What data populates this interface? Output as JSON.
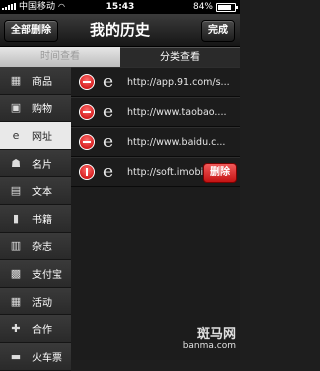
{
  "status_bar": {
    "carrier": "中国移动",
    "time": "15:43",
    "battery_text": "84%",
    "battery_level": 0.84
  },
  "navbar": {
    "left_button": "全部删除",
    "title": "我的历史",
    "right_button": "完成"
  },
  "tabs": [
    {
      "label": "时间查看",
      "active": false
    },
    {
      "label": "分类查看",
      "active": true
    }
  ],
  "sidebar": {
    "items": [
      {
        "label": "商品",
        "icon": "barcode-icon",
        "glyph": "▦",
        "active": false
      },
      {
        "label": "购物",
        "icon": "shopping-icon",
        "glyph": "▣",
        "active": false
      },
      {
        "label": "网址",
        "icon": "ie-icon",
        "glyph": "e",
        "active": true
      },
      {
        "label": "名片",
        "icon": "contact-card-icon",
        "glyph": "☗",
        "active": false
      },
      {
        "label": "文本",
        "icon": "text-icon",
        "glyph": "▤",
        "active": false
      },
      {
        "label": "书籍",
        "icon": "book-icon",
        "glyph": "▮",
        "active": false
      },
      {
        "label": "杂志",
        "icon": "magazine-icon",
        "glyph": "▥",
        "active": false
      },
      {
        "label": "支付宝",
        "icon": "alipay-icon",
        "glyph": "▩",
        "active": false
      },
      {
        "label": "活动",
        "icon": "activity-icon",
        "glyph": "▦",
        "active": false
      },
      {
        "label": "合作",
        "icon": "puzzle-icon",
        "glyph": "✚",
        "active": false
      },
      {
        "label": "火车票",
        "icon": "train-ticket-icon",
        "glyph": "▬",
        "active": false
      }
    ]
  },
  "list": {
    "rows": [
      {
        "url": "http://app.91.com/s...",
        "delete_pressed": false
      },
      {
        "url": "http://www.taobao....",
        "delete_pressed": false
      },
      {
        "url": "http://www.baidu.c...",
        "delete_pressed": false
      },
      {
        "url": "http://soft.imobil",
        "delete_pressed": true
      }
    ],
    "delete_label": "删除"
  },
  "watermark": {
    "top": "斑马网",
    "bottom": "banma.com"
  }
}
